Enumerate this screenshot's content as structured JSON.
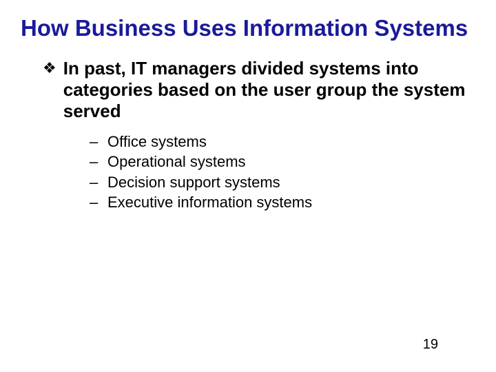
{
  "title": "How Business Uses Information Systems",
  "bullet": "In past, IT managers divided systems into categories based on the user group the system served",
  "subitems": [
    "Office systems",
    "Operational systems",
    "Decision support systems",
    "Executive information systems"
  ],
  "pageNumber": "19"
}
